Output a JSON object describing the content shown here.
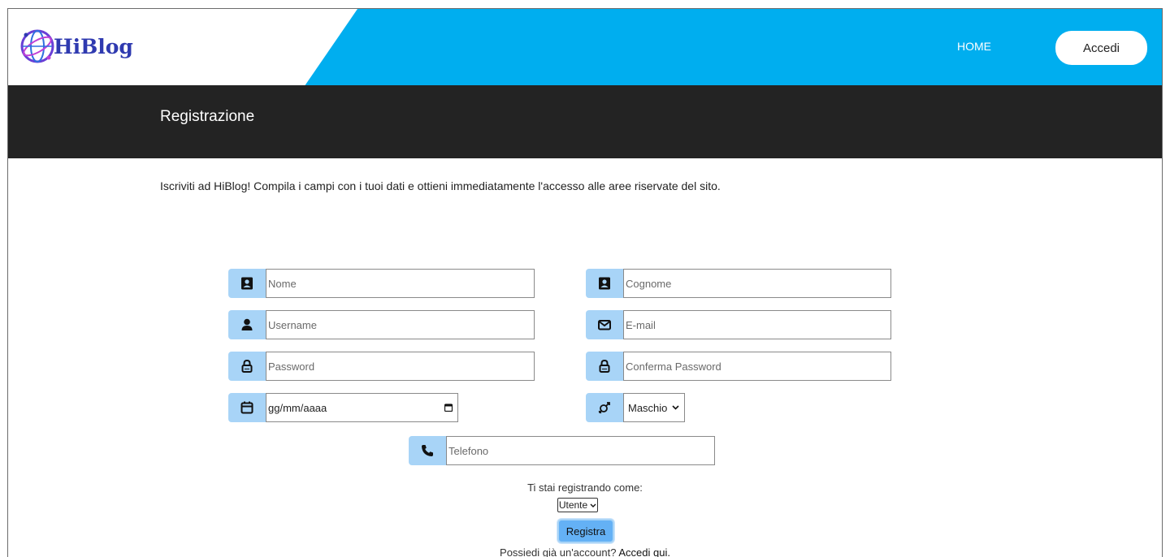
{
  "header": {
    "logo_text": "HiBlog",
    "nav_home": "HOME",
    "login_button": "Accedi"
  },
  "page": {
    "title": "Registrazione",
    "intro": "Iscriviti ad HiBlog! Compila i campi con i tuoi dati e ottieni immediatamente l'accesso alle aree riservate del sito."
  },
  "form": {
    "nome_placeholder": "Nome",
    "cognome_placeholder": "Cognome",
    "username_placeholder": "Username",
    "email_placeholder": "E-mail",
    "password_placeholder": "Password",
    "confirm_password_placeholder": "Conferma Password",
    "date_value": "gg/mm/aaaa",
    "gender_selected": "Maschio",
    "telefono_placeholder": "Telefono",
    "register_as_label": "Ti stai registrando come:",
    "role_selected": "Utente",
    "register_button": "Registra",
    "have_account_text": "Possiedi già un'account?",
    "login_link": "Accedi qui."
  },
  "colors": {
    "header_blue": "#00aeef",
    "dark_band": "#232323",
    "icon_bg": "#a8d4f7",
    "register_button": "#64b1f5",
    "logo_text": "#2f3ab0"
  },
  "icons": {
    "nome": "contact-card-icon",
    "cognome": "contact-card-icon",
    "username": "user-icon",
    "email": "envelope-icon",
    "password": "lock-icon",
    "confirm_password": "lock-icon",
    "date": "calendar-icon",
    "gender": "gender-icon",
    "telefono": "phone-icon"
  }
}
